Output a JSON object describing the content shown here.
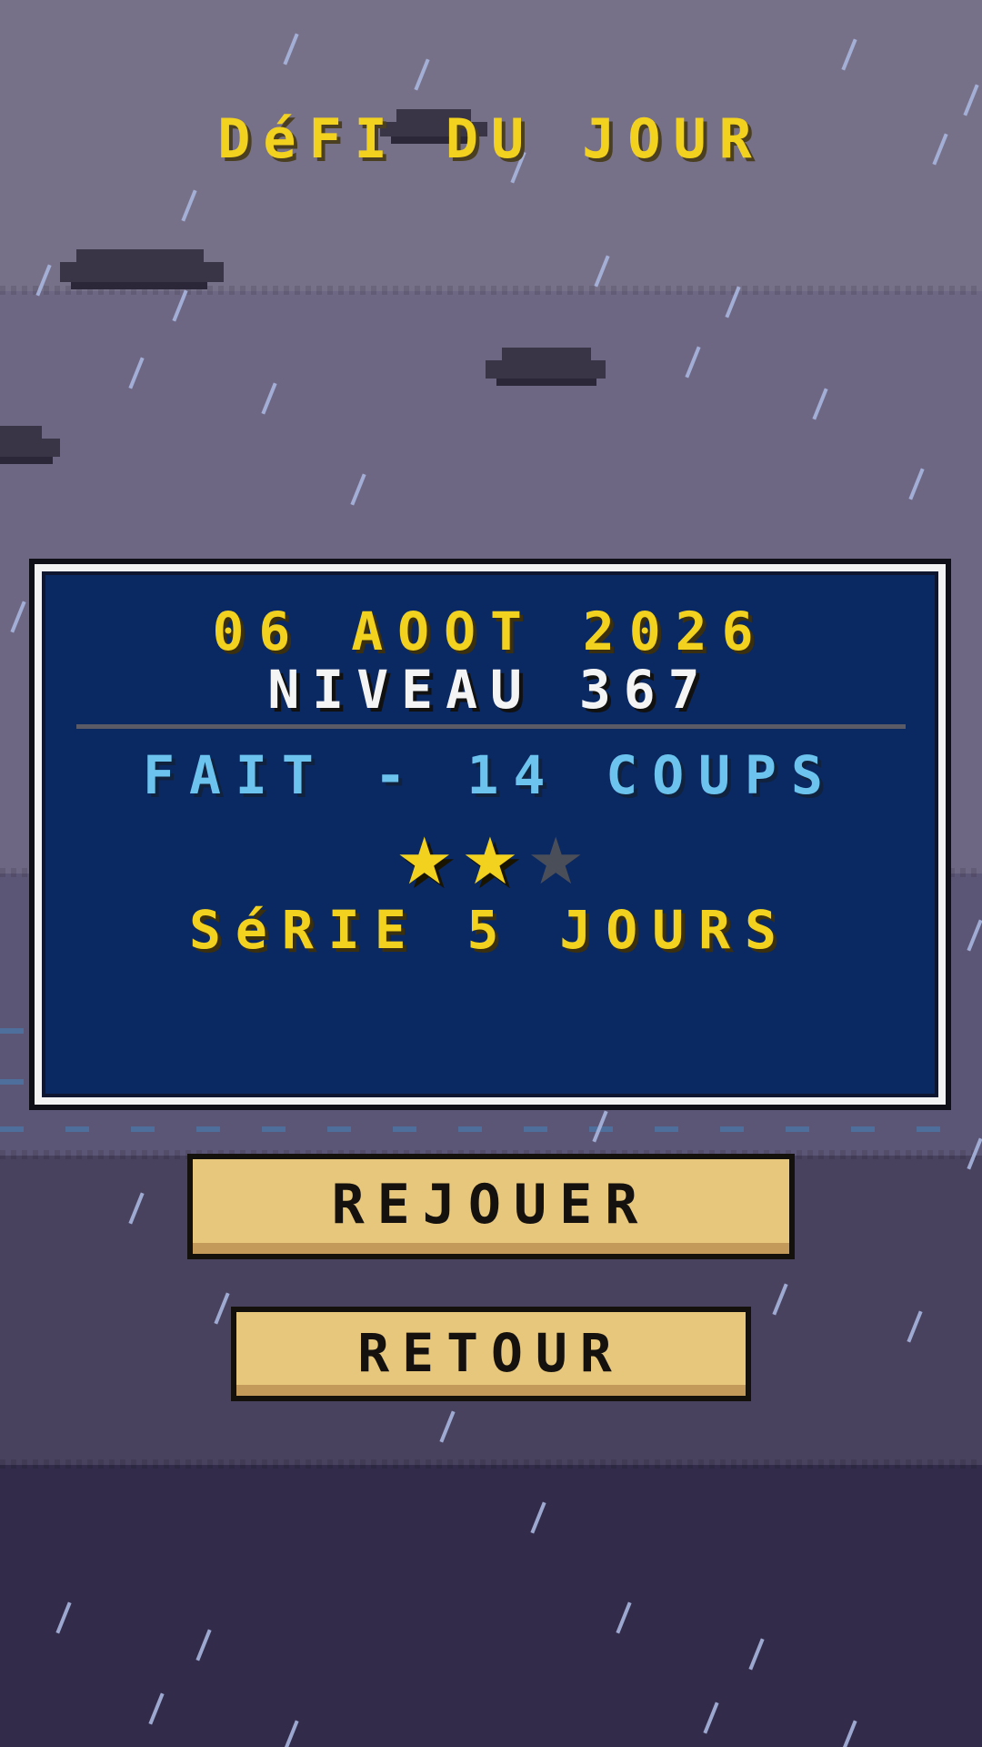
{
  "screen": {
    "title": "DéFI DU JOUR"
  },
  "result_panel": {
    "date": "06 AOOT 2026",
    "level": "NIVEAU 367",
    "result": "FAIT - 14 COUPS",
    "stars_earned": 2,
    "stars_total": 3,
    "streak": "SéRIE 5 JOURS"
  },
  "buttons": {
    "replay_label": "REJOUER",
    "back_label": "RETOUR"
  },
  "colors": {
    "accent_yellow": "#f2d21e",
    "result_blue": "#6cc4ee",
    "panel_bg": "#0a2862",
    "button_bg": "#e6c77c"
  }
}
